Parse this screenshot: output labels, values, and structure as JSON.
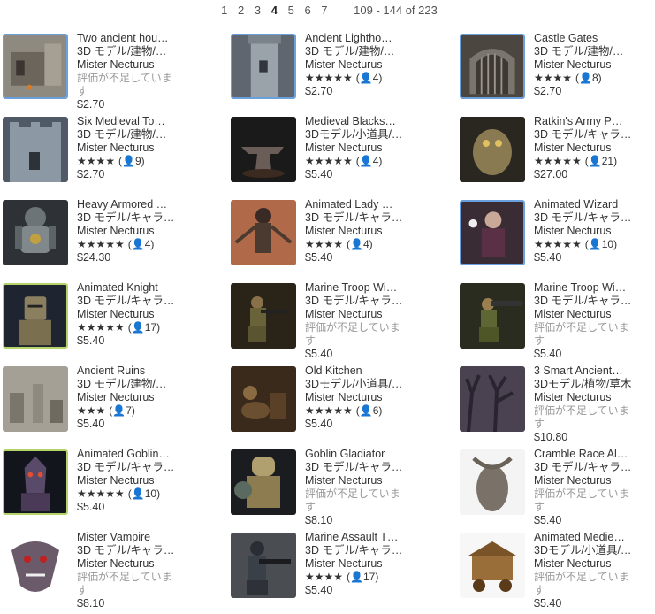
{
  "pager": {
    "pages": [
      "1",
      "2",
      "3",
      "4",
      "5",
      "6",
      "7"
    ],
    "current": "4",
    "range": "109 - 144 of 223"
  },
  "items": [
    {
      "title": "Two ancient hou…",
      "category": "3D モデル/建物/…",
      "publisher": "Mister Necturus",
      "rating": null,
      "count": null,
      "no_rating": "評価が不足しています",
      "price": "$2.70",
      "thumb": "ruins-house",
      "highlight": "blue"
    },
    {
      "title": "Ancient Lightho…",
      "category": "3D モデル/建物/…",
      "publisher": "Mister Necturus",
      "rating": "★★★★★",
      "count": "(👤4)",
      "no_rating": null,
      "price": "$2.70",
      "thumb": "tower",
      "highlight": "blue"
    },
    {
      "title": "Castle Gates",
      "category": "3D モデル/建物/…",
      "publisher": "Mister Necturus",
      "rating": "★★★★",
      "count": "(👤8)",
      "no_rating": null,
      "price": "$2.70",
      "thumb": "gate",
      "highlight": "blue"
    },
    {
      "title": "Six Medieval To…",
      "category": "3D モデル/建物/…",
      "publisher": "Mister Necturus",
      "rating": "★★★★",
      "count": "(👤9)",
      "no_rating": null,
      "price": "$2.70",
      "thumb": "tower2",
      "highlight": "none"
    },
    {
      "title": "Medieval Blacks…",
      "category": "3Dモデル/小道具/…",
      "publisher": "Mister Necturus",
      "rating": "★★★★★",
      "count": "(👤4)",
      "no_rating": null,
      "price": "$5.40",
      "thumb": "anvil",
      "highlight": "none"
    },
    {
      "title": "Ratkin's Army P…",
      "category": "3D モデル/キャラ…",
      "publisher": "Mister Necturus",
      "rating": "★★★★★",
      "count": "(👤21)",
      "no_rating": null,
      "price": "$27.00",
      "thumb": "creature",
      "highlight": "none"
    },
    {
      "title": "Heavy Armored …",
      "category": "3D モデル/キャラ…",
      "publisher": "Mister Necturus",
      "rating": "★★★★★",
      "count": "(👤4)",
      "no_rating": null,
      "price": "$24.30",
      "thumb": "armor",
      "highlight": "none"
    },
    {
      "title": "Animated Lady …",
      "category": "3D モデル/キャラ…",
      "publisher": "Mister Necturus",
      "rating": "★★★★",
      "count": "(👤4)",
      "no_rating": null,
      "price": "$5.40",
      "thumb": "lady",
      "highlight": "none"
    },
    {
      "title": "Animated Wizard",
      "category": "3D モデル/キャラ…",
      "publisher": "Mister Necturus",
      "rating": "★★★★★",
      "count": "(👤10)",
      "no_rating": null,
      "price": "$5.40",
      "thumb": "wizard",
      "highlight": "blue"
    },
    {
      "title": "Animated Knight",
      "category": "3D モデル/キャラ…",
      "publisher": "Mister Necturus",
      "rating": "★★★★★",
      "count": "(👤17)",
      "no_rating": null,
      "price": "$5.40",
      "thumb": "knight",
      "highlight": "green"
    },
    {
      "title": "Marine Troop Wi…",
      "category": "3D モデル/キャラ…",
      "publisher": "Mister Necturus",
      "rating": null,
      "count": null,
      "no_rating": "評価が不足しています",
      "price": "$5.40",
      "thumb": "marine",
      "highlight": "none"
    },
    {
      "title": "Marine Troop Wi…",
      "category": "3D モデル/キャラ…",
      "publisher": "Mister Necturus",
      "rating": null,
      "count": null,
      "no_rating": "評価が不足しています",
      "price": "$5.40",
      "thumb": "marine2",
      "highlight": "none"
    },
    {
      "title": "Ancient Ruins",
      "category": "3D モデル/建物/…",
      "publisher": "Mister Necturus",
      "rating": "★★★",
      "count": "(👤7)",
      "no_rating": null,
      "price": "$5.40",
      "thumb": "ruins",
      "highlight": "none"
    },
    {
      "title": "Old Kitchen",
      "category": "3Dモデル/小道具/…",
      "publisher": "Mister Necturus",
      "rating": "★★★★★",
      "count": "(👤6)",
      "no_rating": null,
      "price": "$5.40",
      "thumb": "kitchen",
      "highlight": "none"
    },
    {
      "title": "3 Smart Ancient…",
      "category": "3Dモデル/植物/草木",
      "publisher": "Mister Necturus",
      "rating": null,
      "count": null,
      "no_rating": "評価が不足しています",
      "price": "$10.80",
      "thumb": "trees",
      "highlight": "none"
    },
    {
      "title": "Animated Goblin…",
      "category": "3D モデル/キャラ…",
      "publisher": "Mister Necturus",
      "rating": "★★★★★",
      "count": "(👤10)",
      "no_rating": null,
      "price": "$5.40",
      "thumb": "goblin",
      "highlight": "green"
    },
    {
      "title": "Goblin Gladiator",
      "category": "3D モデル/キャラ…",
      "publisher": "Mister Necturus",
      "rating": null,
      "count": null,
      "no_rating": "評価が不足しています",
      "price": "$8.10",
      "thumb": "gladiator",
      "highlight": "none"
    },
    {
      "title": "Cramble Race Al…",
      "category": "3D モデル/キャラ…",
      "publisher": "Mister Necturus",
      "rating": null,
      "count": null,
      "no_rating": "評価が不足しています",
      "price": "$5.40",
      "thumb": "cramble",
      "highlight": "none"
    },
    {
      "title": "Mister Vampire",
      "category": "3D モデル/キャラ…",
      "publisher": "Mister Necturus",
      "rating": null,
      "count": null,
      "no_rating": "評価が不足しています",
      "price": "$8.10",
      "thumb": "vampire",
      "highlight": "none"
    },
    {
      "title": "Marine Assault T…",
      "category": "3D モデル/キャラ…",
      "publisher": "Mister Necturus",
      "rating": "★★★★",
      "count": "(👤17)",
      "no_rating": null,
      "price": "$5.40",
      "thumb": "assault",
      "highlight": "none"
    },
    {
      "title": "Animated Medie…",
      "category": "3Dモデル/小道具/…",
      "publisher": "Mister Necturus",
      "rating": null,
      "count": null,
      "no_rating": "評価が不足しています",
      "price": "$5.40",
      "thumb": "cart",
      "highlight": "none"
    }
  ]
}
